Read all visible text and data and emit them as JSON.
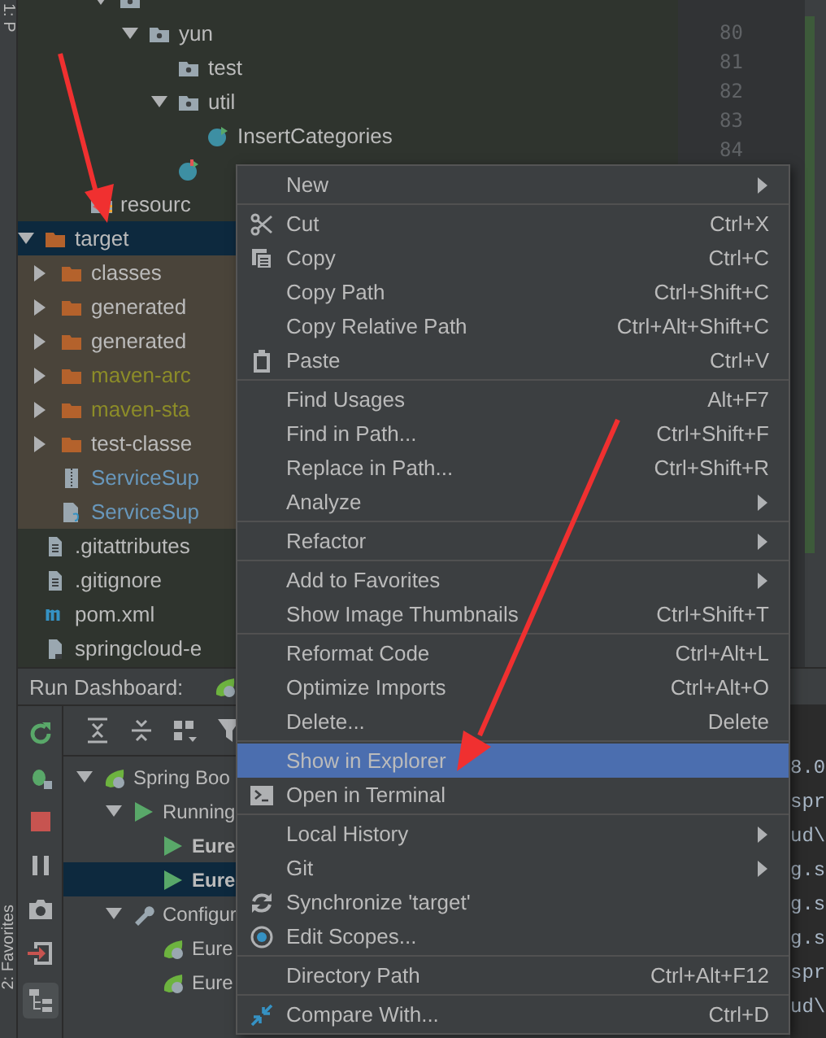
{
  "side_stripe": {
    "top_label": "1: P",
    "bottom_label": "2: Favorites"
  },
  "project_tree": {
    "items": [
      {
        "children": [
          {
            "children": [
              {
                "children": [
                  {
                    "children": [
                      {
                        "kind": "package",
                        "expanded": true,
                        "selected": false,
                        "children": [
                          {
                            "label": "yun",
                            "kind": "package",
                            "expanded": true,
                            "selected": false,
                            "children": [
                              {
                                "label": "test",
                                "kind": "package",
                                "selected": false
                              },
                              {
                                "label": "util",
                                "kind": "package",
                                "expanded": true,
                                "selected": false,
                                "children": [
                                  {
                                    "label": "InsertCategories",
                                    "kind": "class",
                                    "selected": false
                                  }
                                ]
                              },
                              {
                                "kind": "app-class",
                                "selected": false
                              }
                            ]
                          }
                        ]
                      }
                    ]
                  },
                  {
                    "label": "resourc",
                    "kind": "resources",
                    "selected": false
                  }
                ]
              }
            ]
          },
          {
            "label": "target",
            "kind": "folder",
            "expanded": true,
            "selected": true,
            "excluded": true,
            "children": [
              {
                "label": "classes",
                "kind": "folder",
                "expanded": false,
                "selected": false
              },
              {
                "label": "generated",
                "kind": "folder",
                "expanded": false,
                "selected": false
              },
              {
                "label": "generated",
                "kind": "folder",
                "expanded": false,
                "selected": false
              },
              {
                "label": "maven-arc",
                "kind": "folder",
                "expanded": false,
                "selected": false,
                "color": "#8c8c28"
              },
              {
                "label": "maven-sta",
                "kind": "folder",
                "expanded": false,
                "selected": false,
                "color": "#8c8c28"
              },
              {
                "label": "test-classe",
                "kind": "folder",
                "expanded": false,
                "selected": false
              },
              {
                "label": "ServiceSup",
                "kind": "jar",
                "selected": false,
                "color": "#6897bb"
              },
              {
                "label": "ServiceSup",
                "kind": "unknown",
                "selected": false,
                "color": "#6897bb"
              }
            ]
          },
          {
            "label": ".gitattributes",
            "kind": "file",
            "selected": false
          },
          {
            "label": ".gitignore",
            "kind": "file",
            "selected": false
          },
          {
            "label": "pom.xml",
            "kind": "maven",
            "selected": false
          },
          {
            "label": "springcloud-e",
            "kind": "iml",
            "selected": false
          }
        ]
      }
    ]
  },
  "gutter": {
    "line_numbers": [
      "80",
      "81",
      "82",
      "83",
      "84"
    ]
  },
  "run_dashboard": {
    "title": "Run Dashboard:",
    "tools": [
      {
        "kind": "rerun"
      },
      {
        "kind": "debug"
      },
      {
        "kind": "stop"
      },
      {
        "kind": "pause"
      },
      {
        "kind": "camera"
      },
      {
        "kind": "exit"
      },
      {
        "kind": "layout"
      }
    ],
    "toolbar": [
      {
        "kind": "expand-all"
      },
      {
        "kind": "collapse-all"
      },
      {
        "kind": "group"
      },
      {
        "kind": "filter"
      }
    ],
    "tree": [
      {
        "label": "Spring Boo",
        "kind": "spring",
        "expanded": true,
        "selected": false,
        "bold": false,
        "children": [
          {
            "label": "Running",
            "kind": "running",
            "expanded": true,
            "selected": false,
            "bold": false,
            "children": [
              {
                "label": "Eure",
                "kind": "running",
                "selected": false,
                "bold": true
              },
              {
                "label": "Eure",
                "kind": "running",
                "selected": true,
                "bold": true
              }
            ]
          },
          {
            "label": "Configur",
            "kind": "config",
            "expanded": true,
            "selected": false,
            "bold": false,
            "children": [
              {
                "label": "Eure",
                "kind": "spring",
                "selected": false,
                "bold": false
              },
              {
                "label": "Eure",
                "kind": "spring",
                "selected": false,
                "bold": false
              }
            ]
          }
        ]
      }
    ],
    "console": [
      "8.0",
      "spr",
      "ud\\",
      "g.s",
      "g.s",
      "g.s",
      "spr",
      "ud\\"
    ]
  },
  "context_menu": {
    "groups": [
      [
        {
          "label": "New",
          "submenu": true,
          "selected": false
        }
      ],
      [
        {
          "label": "Cut",
          "shortcut": "Ctrl+X",
          "kind": "cut",
          "selected": false
        },
        {
          "label": "Copy",
          "shortcut": "Ctrl+C",
          "kind": "copy",
          "selected": false
        },
        {
          "label": "Copy Path",
          "shortcut": "Ctrl+Shift+C",
          "selected": false
        },
        {
          "label": "Copy Relative Path",
          "shortcut": "Ctrl+Alt+Shift+C",
          "selected": false
        },
        {
          "label": "Paste",
          "shortcut": "Ctrl+V",
          "kind": "paste",
          "selected": false
        }
      ],
      [
        {
          "label": "Find Usages",
          "shortcut": "Alt+F7",
          "selected": false
        },
        {
          "label": "Find in Path...",
          "shortcut": "Ctrl+Shift+F",
          "selected": false
        },
        {
          "label": "Replace in Path...",
          "shortcut": "Ctrl+Shift+R",
          "selected": false
        },
        {
          "label": "Analyze",
          "submenu": true,
          "selected": false
        }
      ],
      [
        {
          "label": "Refactor",
          "submenu": true,
          "selected": false
        }
      ],
      [
        {
          "label": "Add to Favorites",
          "submenu": true,
          "selected": false
        },
        {
          "label": "Show Image Thumbnails",
          "shortcut": "Ctrl+Shift+T",
          "selected": false
        }
      ],
      [
        {
          "label": "Reformat Code",
          "shortcut": "Ctrl+Alt+L",
          "selected": false
        },
        {
          "label": "Optimize Imports",
          "shortcut": "Ctrl+Alt+O",
          "selected": false
        },
        {
          "label": "Delete...",
          "shortcut": "Delete",
          "selected": false
        }
      ],
      [
        {
          "label": "Show in Explorer",
          "selected": true
        },
        {
          "label": "Open in Terminal",
          "kind": "terminal",
          "selected": false
        }
      ],
      [
        {
          "label": "Local History",
          "submenu": true,
          "selected": false
        },
        {
          "label": "Git",
          "submenu": true,
          "selected": false
        },
        {
          "label": "Synchronize 'target'",
          "kind": "sync",
          "selected": false
        },
        {
          "label": "Edit Scopes...",
          "kind": "scope",
          "selected": false
        }
      ],
      [
        {
          "label": "Directory Path",
          "shortcut": "Ctrl+Alt+F12",
          "selected": false
        }
      ],
      [
        {
          "label": "Compare With...",
          "shortcut": "Ctrl+D",
          "kind": "compare",
          "selected": false
        }
      ]
    ]
  }
}
